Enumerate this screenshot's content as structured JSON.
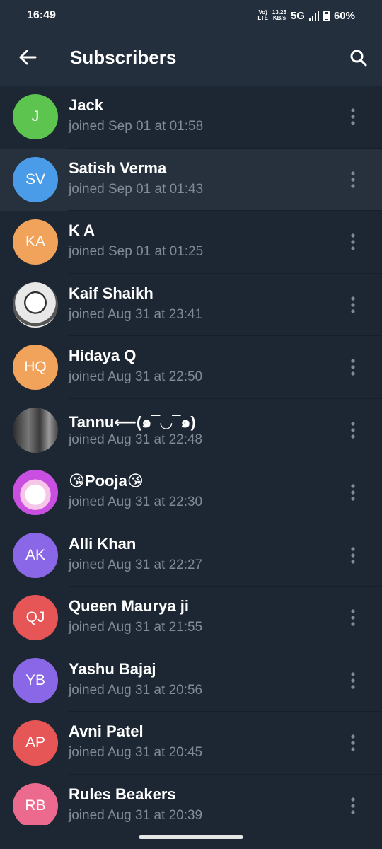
{
  "status_bar": {
    "time": "16:49",
    "volte_top": "Vo)",
    "volte_bottom": "LTE",
    "speed_top": "13.25",
    "speed_bottom": "KB/s",
    "network": "5G",
    "battery": "60%"
  },
  "header": {
    "title": "Subscribers"
  },
  "colors": {
    "background": "#1d2733",
    "header": "#242f3d",
    "secondary_text": "#7f8b98"
  },
  "subscribers": [
    {
      "initials": "J",
      "name": "Jack",
      "joined": "joined Sep 01 at 01:58",
      "avatar_color": "#5cc44f"
    },
    {
      "initials": "SV",
      "name": "Satish Verma",
      "joined": "joined Sep 01 at 01:43",
      "avatar_color": "#4a9ce8"
    },
    {
      "initials": "KA",
      "name": "K A",
      "joined": "joined Sep 01 at 01:25",
      "avatar_color": "#f2a35b"
    },
    {
      "initials": "",
      "name": "Kaif Shaikh",
      "joined": "joined Aug 31 at 23:41",
      "avatar_color": "#f4f4f4",
      "avatar_type": "photo"
    },
    {
      "initials": "HQ",
      "name": "Hidaya Q",
      "joined": "joined Aug 31 at 22:50",
      "avatar_color": "#f2a35b"
    },
    {
      "initials": "",
      "name": "Tannu⟵(๑¯◡¯๑)",
      "joined": "joined Aug 31 at 22:48",
      "avatar_color": "#4a4a4a",
      "avatar_type": "photo"
    },
    {
      "initials": "",
      "name": "😘Pooja😘",
      "joined": "joined Aug 31 at 22:30",
      "avatar_color": "#c94fe0",
      "avatar_type": "photo"
    },
    {
      "initials": "AK",
      "name": "Alli Khan",
      "joined": "joined Aug 31 at 22:27",
      "avatar_color": "#8a67e6"
    },
    {
      "initials": "QJ",
      "name": "Queen Maurya ji",
      "joined": "joined Aug 31 at 21:55",
      "avatar_color": "#e65656"
    },
    {
      "initials": "YB",
      "name": "Yashu Bajaj",
      "joined": "joined Aug 31 at 20:56",
      "avatar_color": "#8a67e6"
    },
    {
      "initials": "AP",
      "name": "Avni Patel",
      "joined": "joined Aug 31 at 20:45",
      "avatar_color": "#e65656"
    },
    {
      "initials": "RB",
      "name": "Rules Beakers",
      "joined": "joined Aug 31 at 20:39",
      "avatar_color": "#ec6a8d"
    }
  ]
}
